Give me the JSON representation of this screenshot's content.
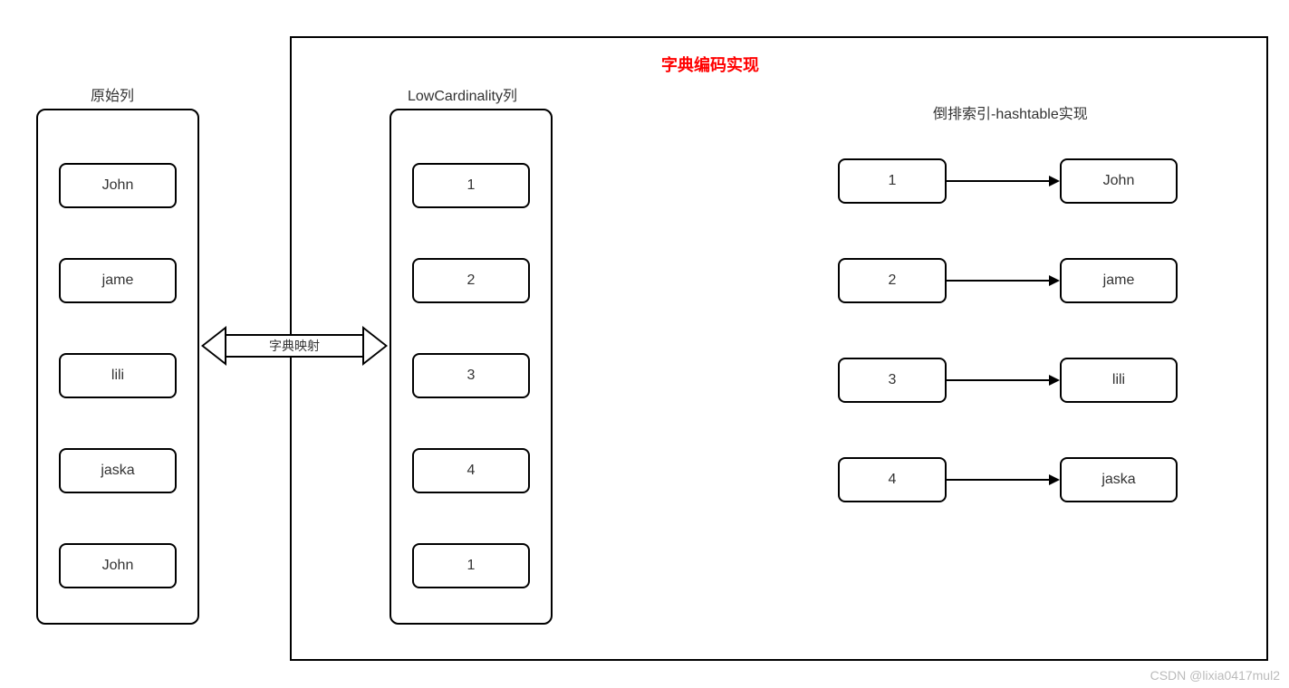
{
  "title": "字典编码实现",
  "original_column": {
    "label": "原始列",
    "items": [
      "John",
      "jame",
      "lili",
      "jaska",
      "John"
    ]
  },
  "mapping_label": "字典映射",
  "low_cardinality": {
    "label": "LowCardinality列",
    "items": [
      "1",
      "2",
      "3",
      "4",
      "1"
    ]
  },
  "inverted_index": {
    "label": "倒排索引-hashtable实现",
    "pairs": [
      {
        "key": "1",
        "value": "John"
      },
      {
        "key": "2",
        "value": "jame"
      },
      {
        "key": "3",
        "value": "lili"
      },
      {
        "key": "4",
        "value": "jaska"
      }
    ]
  },
  "watermark": "CSDN @lixia0417mul2"
}
